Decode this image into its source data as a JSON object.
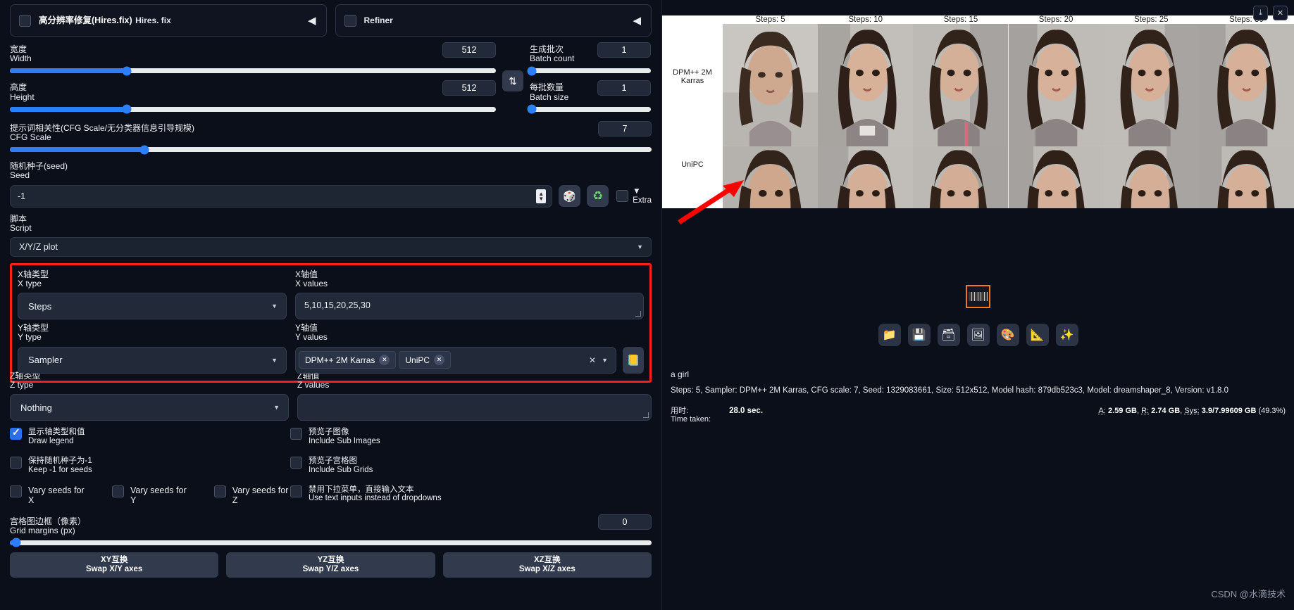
{
  "left_panel": {
    "hires": {
      "cn": "高分辨率修复(Hires.fix)",
      "en": "Hires. fix",
      "checked": false,
      "arrow": "◀"
    },
    "refiner": {
      "cn": "",
      "en": "Refiner",
      "checked": false,
      "arrow": "◀"
    },
    "width": {
      "cn": "宽度",
      "en": "Width",
      "value": "512",
      "pct": 24
    },
    "height": {
      "cn": "高度",
      "en": "Height",
      "value": "512",
      "pct": 24
    },
    "cfg": {
      "cn": "提示词相关性(CFG Scale/无分类器信息引导规模)",
      "en": "CFG Scale",
      "value": "7",
      "pct": 21
    },
    "batch_count": {
      "cn": "生成批次",
      "en": "Batch count",
      "value": "1",
      "pct": 2
    },
    "batch_size": {
      "cn": "每批数量",
      "en": "Batch size",
      "value": "1",
      "pct": 2
    },
    "swap_dims_icon": "⇅",
    "seed": {
      "cn": "随机种子(seed)",
      "en": "Seed",
      "value": "-1",
      "dice_icon": "🎲",
      "recycle_icon": "♻",
      "extra_label": "Extra",
      "extra_checked": false,
      "extra_caret": "▼"
    },
    "script": {
      "cn": "脚本",
      "en": "Script",
      "selected": "X/Y/Z plot",
      "caret": "▼"
    },
    "x_type": {
      "cn": "X轴类型",
      "en": "X type",
      "value": "Steps",
      "caret": "▼"
    },
    "x_values": {
      "cn": "X轴值",
      "en": "X values",
      "value": "5,10,15,20,25,30"
    },
    "y_type": {
      "cn": "Y轴类型",
      "en": "Y type",
      "value": "Sampler",
      "caret": "▼"
    },
    "y_values": {
      "cn": "Y轴值",
      "en": "Y values",
      "tokens": [
        "DPM++ 2M Karras",
        "UniPC"
      ],
      "token_x": "✕",
      "clear_all": "✕",
      "caret": "▼"
    },
    "y_list_icon": "📒",
    "z_type": {
      "cn": "Z轴类型",
      "en": "Z type",
      "value": "Nothing",
      "caret": "▼"
    },
    "z_values": {
      "cn": "Z轴值",
      "en": "Z values",
      "value": ""
    },
    "checkboxes": [
      {
        "cn": "显示轴类型和值",
        "en": "Draw legend",
        "checked": true
      },
      {
        "cn": "预览子图像",
        "en": "Include Sub Images",
        "checked": false
      },
      {
        "cn": "保持随机种子为-1",
        "en": "Keep -1 for seeds",
        "checked": false
      },
      {
        "cn": "预览子宫格图",
        "en": "Include Sub Grids",
        "checked": false
      },
      {
        "cn": "禁用下拉菜单，直接输入文本",
        "en": "Use text inputs instead of dropdowns",
        "checked": false
      }
    ],
    "vary": [
      {
        "en": "Vary seeds for X",
        "checked": false
      },
      {
        "en": "Vary seeds for Y",
        "checked": false
      },
      {
        "en": "Vary seeds for Z",
        "checked": false
      }
    ],
    "grid_margins": {
      "cn": "宫格图边框（像素）",
      "en": "Grid margins (px)",
      "value": "0",
      "pct": 1
    },
    "swap_buttons": [
      {
        "cn": "XY互换",
        "en": "Swap X/Y axes"
      },
      {
        "cn": "YZ互换",
        "en": "Swap Y/Z axes"
      },
      {
        "cn": "XZ互换",
        "en": "Swap X/Z axes"
      }
    ]
  },
  "right_panel": {
    "download_icon": "⤓",
    "close_icon": "✕",
    "grid": {
      "col_headers": [
        "Steps: 5",
        "Steps: 10",
        "Steps: 15",
        "Steps: 20",
        "Steps: 25",
        "Steps: 30"
      ],
      "row_labels": [
        "DPM++ 2M Karras",
        "UniPC"
      ]
    },
    "toolbar_icons": [
      "folder-icon",
      "save-icon",
      "zip-icon",
      "image-icon",
      "palette-icon",
      "ruler-icon",
      "sparkles-icon"
    ],
    "toolbar_glyphs": [
      "📁",
      "💾",
      "🗃",
      "🖼",
      "🎨",
      "📐",
      "✨"
    ],
    "prompt": "a girl",
    "meta": "Steps: 5, Sampler: DPM++ 2M Karras, CFG scale: 7, Seed: 1329083661, Size: 512x512, Model hash: 879db523c3, Model: dreamshaper_8, Version: v1.8.0",
    "time": {
      "cn": "用时:",
      "en": "Time taken:",
      "value": "28.0 sec."
    },
    "memory": {
      "a_label": "A:",
      "a_value": "2.59 GB",
      "r_label": "R:",
      "r_value": "2.74 GB",
      "sys_label": "Sys:",
      "sys_value": "3.9/7.99609 GB",
      "sys_pct": "(49.3%)"
    },
    "watermark": "CSDN @水滴技术"
  },
  "colors": {
    "accent": "#2d7ff9",
    "highlight": "#ff1e1e",
    "thumb_border": "#f07820",
    "arrow": "#ff0000"
  }
}
